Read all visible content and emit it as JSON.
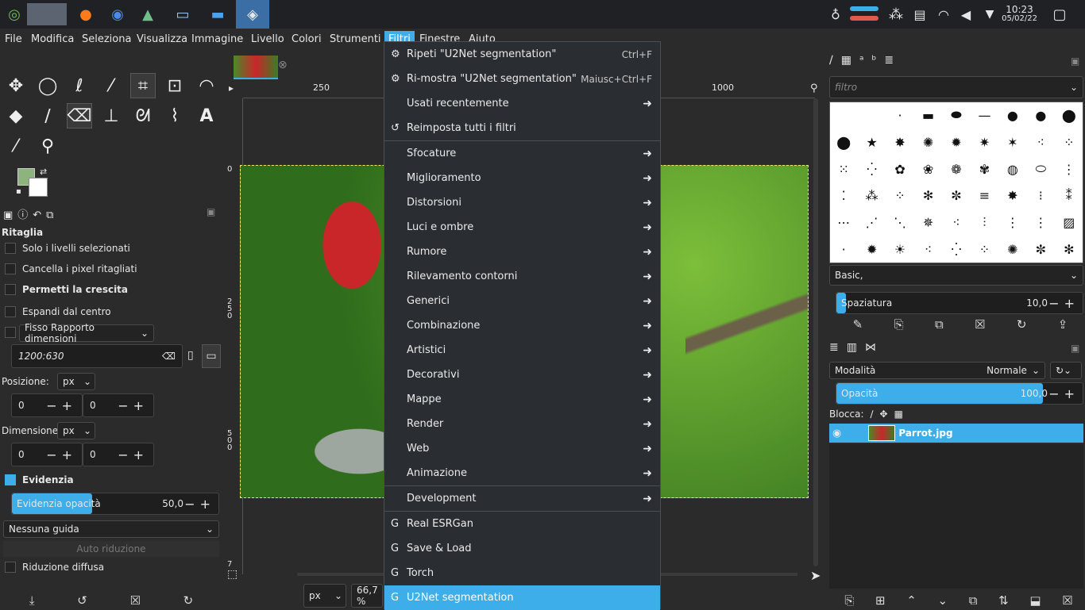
{
  "taskbar": {
    "icons": [
      "app-launcher-icon",
      "virtual-desktops-icon",
      "firefox-icon",
      "chromium-icon",
      "image-viewer-icon",
      "terminal-icon",
      "file-manager-icon",
      "gimp-icon"
    ],
    "time": "10:23",
    "date": "05/02/22"
  },
  "menubar": {
    "items": [
      "File",
      "Modifica",
      "Seleziona",
      "Visualizza",
      "Immagine",
      "Livello",
      "Colori",
      "Strumenti",
      "Filtri",
      "Finestre",
      "Aiuto"
    ],
    "active": "Filtri"
  },
  "filters_menu": {
    "repeat": {
      "label": "Ripeti \"U2Net segmentation\"",
      "shortcut": "Ctrl+F"
    },
    "reshow": {
      "label": "Ri-mostra \"U2Net segmentation\"",
      "shortcut": "Maiusc+Ctrl+F"
    },
    "recent": {
      "label": "Usati recentemente"
    },
    "reset": {
      "label": "Reimposta tutti i filtri"
    },
    "groups": [
      "Sfocature",
      "Miglioramento",
      "Distorsioni",
      "Luci e ombre",
      "Rumore",
      "Rilevamento contorni",
      "Generici",
      "Combinazione",
      "Artistici",
      "Decorativi",
      "Mappe",
      "Render",
      "Web",
      "Animazione"
    ],
    "development": "Development",
    "plugins": [
      "Real ESRGan",
      "Save & Load",
      "Torch",
      "U2Net segmentation"
    ],
    "highlighted": "U2Net segmentation"
  },
  "tool_options": {
    "title": "Ritaglia",
    "only_selected_layers": "Solo i livelli selezionati",
    "delete_cropped": "Cancella i pixel ritagliati",
    "allow_growing": "Permetti la crescita",
    "expand_center": "Espandi dal centro",
    "fixed_ratio": "Fisso Rapporto dimensioni",
    "ratio_value": "1200:630",
    "position_label": "Posizione:",
    "position_unit": "px",
    "position_x": "0",
    "position_y": "0",
    "size_label": "Dimensione:",
    "size_unit": "px",
    "size_w": "0",
    "size_h": "0",
    "highlight": "Evidenzia",
    "highlight_opacity_label": "Evidenzia opacità",
    "highlight_opacity_value": "50,0",
    "highlight_opacity": 0.5,
    "guides": "Nessuna guida",
    "auto_shrink": "Auto riduzione",
    "shrink_merged": "Riduzione diffusa"
  },
  "canvas": {
    "ruler_top": [
      "250",
      "1000"
    ],
    "ruler_left": [
      "0",
      "250",
      "500",
      "7"
    ],
    "unit": "px",
    "zoom": "66,7 %"
  },
  "brushes": {
    "filter_placeholder": "filtro",
    "preset": "Basic,",
    "spacing_label": "Spaziatura",
    "spacing_value": "10,0",
    "spacing": 0.1
  },
  "layers": {
    "mode_label": "Modalità",
    "mode_value": "Normale",
    "opacity_label": "Opacità",
    "opacity_value": "100,0",
    "opacity": 1.0,
    "lock_label": "Blocca:",
    "layer_name": "Parrot.jpg"
  },
  "colors": {
    "accent": "#3daee9",
    "fg_color": "#8db37e",
    "bg_color": "#ffffff"
  }
}
